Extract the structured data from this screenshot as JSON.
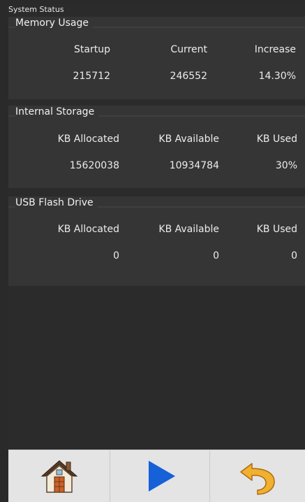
{
  "window": {
    "title": "System Status"
  },
  "memory": {
    "title": "Memory Usage",
    "headers": [
      "Startup",
      "Current",
      "Increase"
    ],
    "values": [
      "215712",
      "246552",
      "14.30%"
    ]
  },
  "internal": {
    "title": "Internal Storage",
    "headers": [
      "KB Allocated",
      "KB Available",
      "KB Used"
    ],
    "values": [
      "15620038",
      "10934784",
      "30%"
    ]
  },
  "usb": {
    "title": "USB Flash Drive",
    "headers": [
      "KB Allocated",
      "KB Available",
      "KB Used"
    ],
    "values": [
      "0",
      "0",
      "0"
    ]
  },
  "toolbar": {
    "buttons": [
      {
        "icon": "home-icon"
      },
      {
        "icon": "play-icon",
        "color": "#1660d8"
      },
      {
        "icon": "undo-icon",
        "color": "#e89a18"
      }
    ]
  }
}
